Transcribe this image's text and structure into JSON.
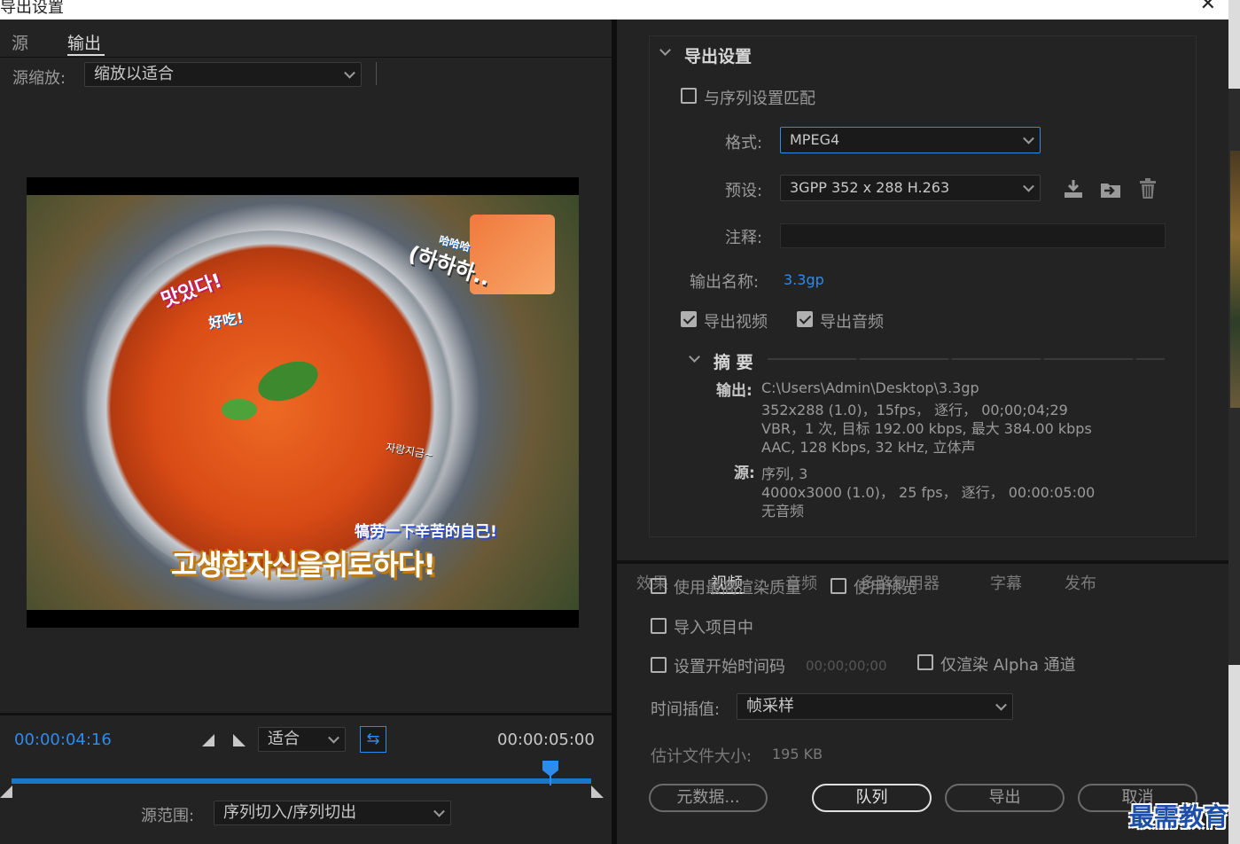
{
  "window": {
    "title": "导出设置",
    "close_glyph": "✕"
  },
  "left": {
    "tabs": {
      "source": "源",
      "output": "输出"
    },
    "scale_label": "源缩放:",
    "scale_value": "缩放以适合",
    "preview_captions": {
      "kr1": "맛있다!",
      "cn1": "好吃!",
      "kr2": "(하하하..",
      "cn2": "哈哈哈",
      "kr3": "자랑지금~",
      "cn3": "犒劳一下辛苦的自己!",
      "kr4": "고생한자신을위로하다!"
    },
    "time_current": "00:00:04:16",
    "time_total": "00:00:05:00",
    "fit_value": "适合",
    "playhead_fraction": 0.93,
    "range_label": "源范围:",
    "range_value": "序列切入/序列切出"
  },
  "export": {
    "title": "导出设置",
    "match_label": "与序列设置匹配",
    "match_checked": false,
    "format_label": "格式:",
    "format_value": "MPEG4",
    "preset_label": "预设:",
    "preset_value": "3GPP 352 x 288 H.263",
    "comment_label": "注释:",
    "comment_value": "",
    "output_name_label": "输出名称:",
    "output_name": "3.3gp",
    "export_video_label": "导出视频",
    "export_video_checked": true,
    "export_audio_label": "导出音频",
    "export_audio_checked": true
  },
  "summary": {
    "title": "摘 要",
    "output_key": "输出:",
    "output_lines": [
      "C:\\Users\\Admin\\Desktop\\3.3gp",
      "352x288 (1.0)，15fps， 逐行， 00;00;04;29",
      "VBR，1 次, 目标 192.00 kbps, 最大 384.00 kbps",
      "AAC, 128 Kbps, 32  kHz, 立体声"
    ],
    "source_key": "源:",
    "source_lines": [
      "序列, 3",
      "4000x3000 (1.0)， 25 fps， 逐行， 00:00:05:00",
      "无音频"
    ]
  },
  "lower_tabs": {
    "effects": "效果",
    "video": "视频",
    "audio": "音频",
    "mux": "多路复用器",
    "captions": "字幕",
    "publish": "发布"
  },
  "options": {
    "max_quality_label": "使用最高渲染质量",
    "use_previews_label": "使用预览",
    "import_label": "导入项目中",
    "start_tc_label": "设置开始时间码",
    "start_tc_value": "00;00;00;00",
    "alpha_label": "仅渲染 Alpha 通道",
    "interp_label": "时间插值:",
    "interp_value": "帧采样",
    "filesize_label": "估计文件大小:",
    "filesize_value": "195 KB"
  },
  "buttons": {
    "metadata": "元数据...",
    "queue": "队列",
    "export": "导出",
    "cancel": "取消"
  },
  "watermark": "最需教育",
  "colors": {
    "accent": "#2d8ceb",
    "panel": "#232323",
    "text": "#9a9a9a"
  }
}
